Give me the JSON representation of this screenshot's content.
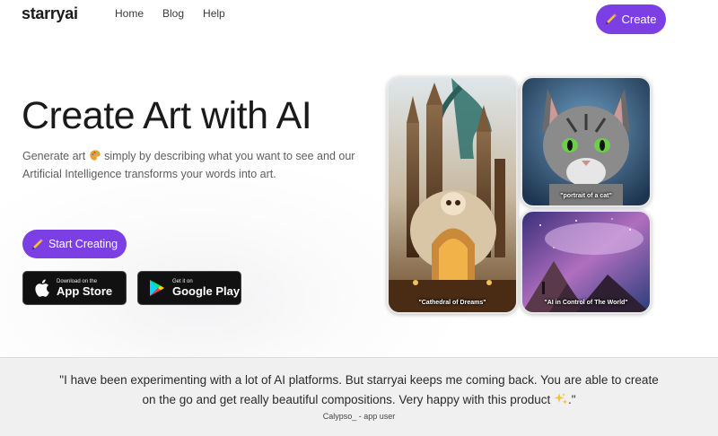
{
  "nav": {
    "logo": "starryai",
    "links": [
      "Home",
      "Blog",
      "Help"
    ],
    "create_label": "Create"
  },
  "hero": {
    "title": "Create Art with AI",
    "subtitle_part1": "Generate art ",
    "subtitle_part2": " simply by describing what you want to see and our Artificial Intelligence transforms your words into art.",
    "start_label": "Start Creating"
  },
  "stores": {
    "apple": {
      "small": "Download on the",
      "big": "App Store"
    },
    "google": {
      "small": "Get it on",
      "big": "Google Play"
    }
  },
  "gallery": [
    {
      "caption": "\"Cathedral of Dreams\""
    },
    {
      "caption": "\"portrait of a cat\""
    },
    {
      "caption": "\"AI in Control of The World\""
    }
  ],
  "testimonial": {
    "quote_line1": "\"I have been experimenting with a lot of AI platforms. But starryai keeps me coming back. You are able to create",
    "quote_line2": "on the go and get really beautiful compositions. Very happy with this product ",
    "quote_end": ".\"",
    "author": "Calypso_ - app user"
  },
  "colors": {
    "accent": "#7b3fe4"
  }
}
